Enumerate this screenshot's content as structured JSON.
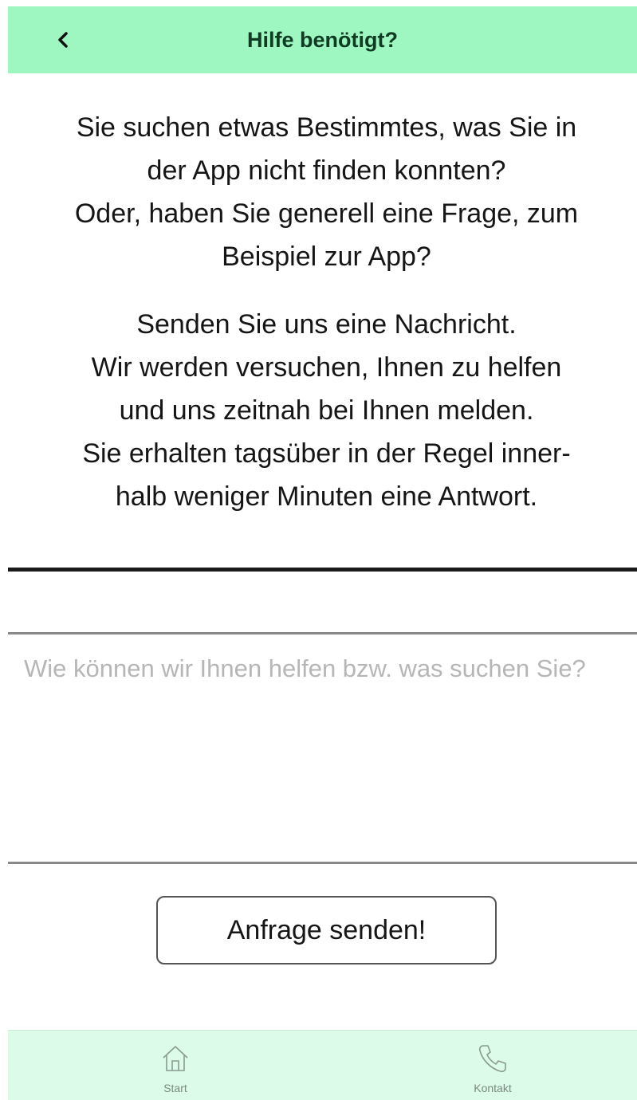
{
  "header": {
    "title": "Hilfe benötigt?",
    "back_icon": "chevron-left-icon",
    "background_color": "#9ef7c0"
  },
  "intro": {
    "paragraph1": [
      "Sie suchen etwas Bestimmtes, was Sie in",
      "der App nicht finden konnten?",
      "Oder, haben Sie generell eine Frage, zum",
      "Beispiel zur App?"
    ],
    "paragraph2": [
      "Senden Sie uns eine Nachricht.",
      "Wir werden versuchen, Ihnen zu helfen",
      "und uns zeitnah bei Ihnen melden.",
      "Sie erhalten tagsüber in der Regel inner-",
      "halb weniger Minuten eine Antwort."
    ]
  },
  "form": {
    "message_value": "",
    "message_placeholder": "Wie können wir Ihnen helfen bzw. was suchen Sie?",
    "submit_label": "Anfrage senden!"
  },
  "tabbar": {
    "background_color": "#dcfbe8",
    "items": [
      {
        "label": "Start",
        "icon": "home-icon"
      },
      {
        "label": "Kontakt",
        "icon": "phone-icon"
      }
    ]
  }
}
